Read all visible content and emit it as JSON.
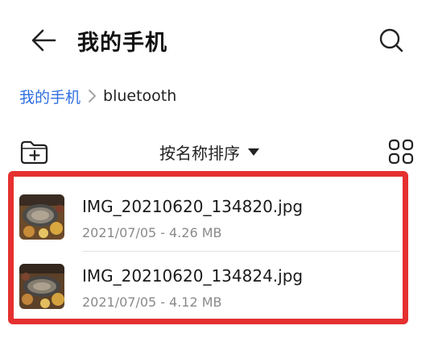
{
  "header": {
    "title": "我的手机",
    "back_icon": "back-arrow-icon",
    "search_icon": "search-icon"
  },
  "breadcrumb": {
    "root": "我的手机",
    "current": "bluetooth",
    "separator_icon": "chevron-right-icon"
  },
  "toolbar": {
    "new_folder_icon": "new-folder-icon",
    "sort_label": "按名称排序",
    "sort_icon": "caret-down-icon",
    "view_icon": "grid-view-icon"
  },
  "files": [
    {
      "name": "IMG_20210620_134820.jpg",
      "date": "2021/07/05",
      "size": "4.26 MB"
    },
    {
      "name": "IMG_20210620_134824.jpg",
      "date": "2021/07/05",
      "size": "4.12 MB"
    }
  ],
  "meta_separator": "-",
  "colors": {
    "accent": "#2f6fe0",
    "highlight": "#e5302f",
    "meta_text": "#8a8a8a"
  }
}
